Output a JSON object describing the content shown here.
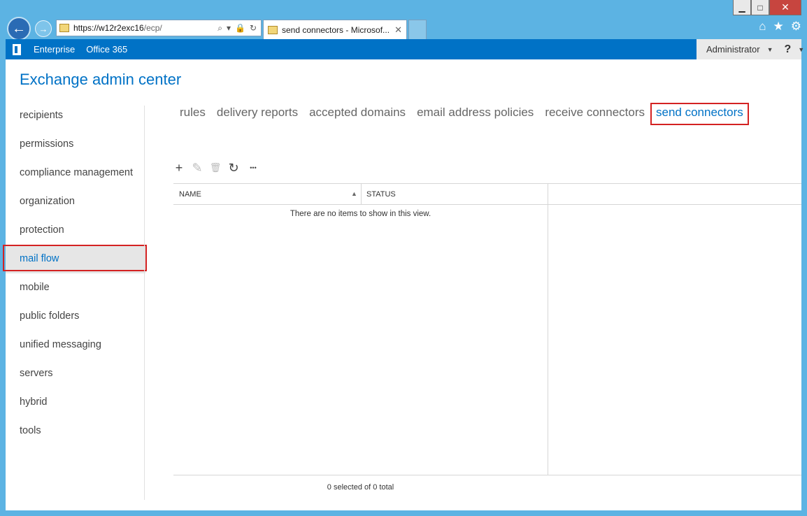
{
  "window": {
    "minimize_label": "▁",
    "maximize_label": "□",
    "close_label": "✕"
  },
  "browser": {
    "address_host": "https://w12r2exc16",
    "address_path": "/ecp/",
    "tab_title": "send connectors - Microsof...",
    "tab_close": "✕"
  },
  "o365bar": {
    "links": [
      "Enterprise",
      "Office 365"
    ],
    "user": "Administrator",
    "help": "?"
  },
  "app": {
    "title": "Exchange admin center"
  },
  "leftnav": {
    "items": [
      {
        "label": "recipients"
      },
      {
        "label": "permissions"
      },
      {
        "label": "compliance management"
      },
      {
        "label": "organization"
      },
      {
        "label": "protection"
      },
      {
        "label": "mail flow",
        "active": true
      },
      {
        "label": "mobile"
      },
      {
        "label": "public folders"
      },
      {
        "label": "unified messaging"
      },
      {
        "label": "servers"
      },
      {
        "label": "hybrid"
      },
      {
        "label": "tools"
      }
    ]
  },
  "subtabs": {
    "items": [
      {
        "label": "rules"
      },
      {
        "label": "delivery reports"
      },
      {
        "label": "accepted domains"
      },
      {
        "label": "email address policies"
      },
      {
        "label": "receive connectors"
      },
      {
        "label": "send connectors",
        "active": true
      }
    ]
  },
  "actions": {
    "add": "+",
    "edit": "✎",
    "delete": "🗑",
    "refresh": "↻",
    "more": "•••"
  },
  "grid": {
    "columns": [
      "NAME",
      "STATUS"
    ],
    "sort_indicator": "▲",
    "empty_message": "There are no items to show in this view.",
    "status": "0 selected of 0 total"
  },
  "colors": {
    "accent": "#0072c6",
    "highlight_border": "#d42222",
    "window_frame": "#5cb3e3"
  }
}
